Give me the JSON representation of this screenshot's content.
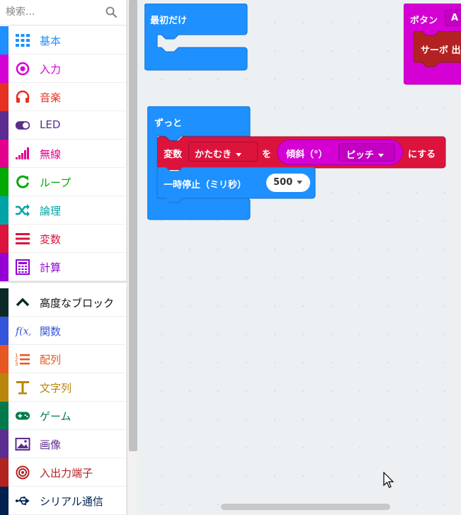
{
  "search": {
    "placeholder": "検索..."
  },
  "categories": [
    {
      "label": "基本",
      "color": "#1e90ff",
      "icon": "grid-icon"
    },
    {
      "label": "入力",
      "color": "#d400d4",
      "icon": "radio-button-icon"
    },
    {
      "label": "音楽",
      "color": "#e63022",
      "icon": "headphones-icon"
    },
    {
      "label": "LED",
      "color": "#5c2d91",
      "icon": "toggle-icon"
    },
    {
      "label": "無線",
      "color": "#e3008c",
      "icon": "signal-bars-icon"
    },
    {
      "label": "ループ",
      "color": "#00aa00",
      "icon": "refresh-icon"
    },
    {
      "label": "論理",
      "color": "#00a4a6",
      "icon": "shuffle-icon"
    },
    {
      "label": "変数",
      "color": "#dc143c",
      "icon": "lines-icon"
    },
    {
      "label": "計算",
      "color": "#9400d3",
      "icon": "calculator-icon"
    }
  ],
  "advanced": {
    "label": "高度なブロック",
    "color": "#0b2a27",
    "icon": "chevron-up-icon"
  },
  "advanced_categories": [
    {
      "label": "関数",
      "color": "#3455db",
      "icon": "function-icon"
    },
    {
      "label": "配列",
      "color": "#e65722",
      "icon": "list-icon"
    },
    {
      "label": "文字列",
      "color": "#b8860b",
      "icon": "text-icon"
    },
    {
      "label": "ゲーム",
      "color": "#007a4b",
      "icon": "gamepad-icon"
    },
    {
      "label": "画像",
      "color": "#5c2d91",
      "icon": "image-icon"
    },
    {
      "label": "入出力端子",
      "color": "#b22222",
      "icon": "target-icon"
    },
    {
      "label": "シリアル通信",
      "color": "#002050",
      "icon": "usb-icon"
    }
  ],
  "blocks": {
    "on_start": {
      "label": "最初だけ",
      "color": "#1e90ff"
    },
    "forever": {
      "label": "ずっと",
      "color": "#1e90ff"
    },
    "set_var": {
      "label_prefix": "変数",
      "variable": "かたむき",
      "label_mid": "を",
      "sensor": "傾斜（°）",
      "axis": "ピッチ",
      "label_suffix": "にする",
      "color": "#dc143c"
    },
    "pause": {
      "label": "一時停止（ミリ秒）",
      "value": "500",
      "color": "#1e90ff"
    },
    "button_event": {
      "label": "ボタン",
      "button": "A",
      "color": "#d400d4"
    },
    "servo": {
      "label": "サーボ 出",
      "color": "#b22222"
    }
  }
}
